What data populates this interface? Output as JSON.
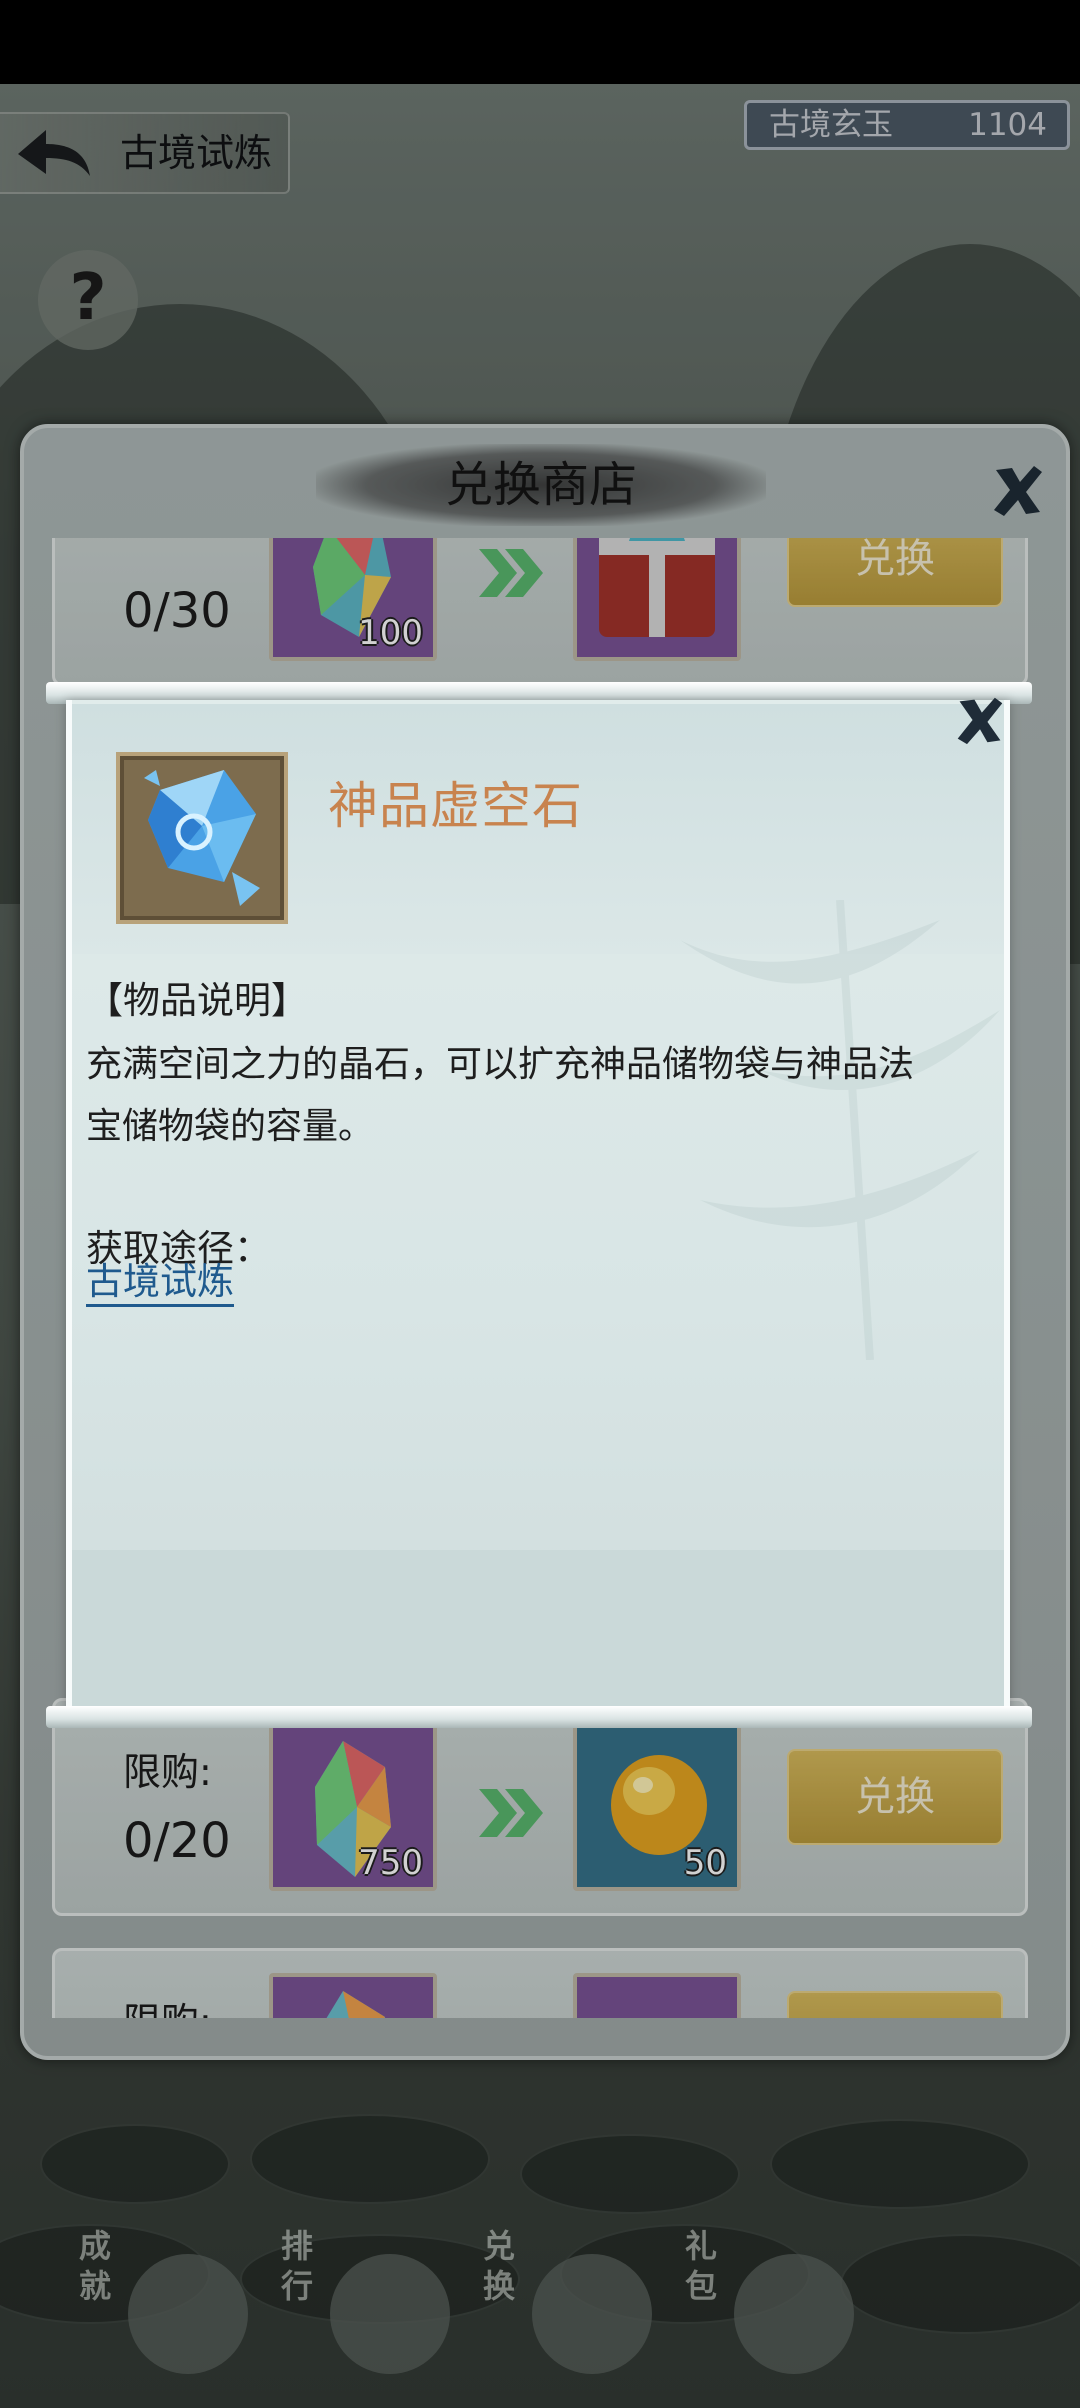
{
  "header": {
    "back_icon": "back-arrow-icon",
    "title": "古境试炼",
    "currency": {
      "name": "古境玄玉",
      "value": "1104"
    },
    "help_icon": "question-icon",
    "help_symbol": "?"
  },
  "shop": {
    "title": "兑换商店",
    "close_icon": "close-x-icon",
    "rows": [
      {
        "limit_label": "",
        "count": "0/30",
        "cost_item": "rainbow-crystal-icon",
        "cost_qty": "100",
        "reward_item": "treasure-chest-icon",
        "reward_qty": "",
        "button": "兑换"
      },
      {
        "limit_label": "限购:",
        "count": "0/20",
        "cost_item": "rainbow-crystal-icon",
        "cost_qty": "750",
        "reward_item": "golden-orb-icon",
        "reward_qty": "50",
        "button": "兑换"
      },
      {
        "limit_label": "限购:",
        "count": "",
        "cost_item": "rainbow-crystal-icon",
        "cost_qty": "",
        "reward_item": "item-icon",
        "reward_qty": "",
        "button": ""
      }
    ]
  },
  "item_popup": {
    "close_icon": "close-x-icon",
    "item_icon": "void-stone-crystal-icon",
    "item_name": "神品虚空石",
    "desc_title": "【物品说明】",
    "description": "充满空间之力的晶石，可以扩充神品储物袋与神品法宝储物袋的容量。",
    "source_label": "获取途径：",
    "source_link": "古境试炼"
  },
  "bottom_nav": [
    {
      "label": "成就",
      "icon": "scroll-icon"
    },
    {
      "label": "排行",
      "icon": "banner-icon"
    },
    {
      "label": "兑换",
      "icon": "exchange-shield-icon"
    },
    {
      "label": "礼包",
      "icon": "gift-box-icon"
    }
  ],
  "colors": {
    "item_name": "#c8834e",
    "link": "#1f5a8e",
    "exchange_button": "#c8aa4c",
    "cost_slot": "#7a5497",
    "reward_slot": "#36728a"
  }
}
